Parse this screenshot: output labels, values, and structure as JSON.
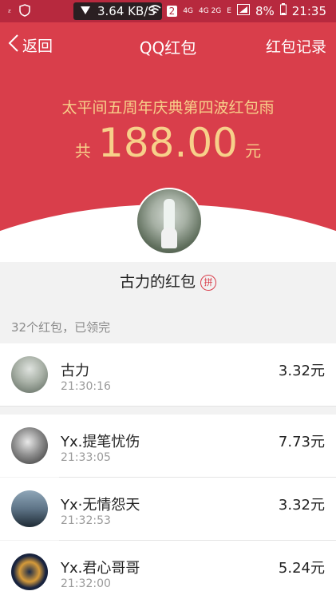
{
  "status_bar": {
    "net_speed": "3.64 KB/S",
    "sim_badge": "2",
    "battery": "8%",
    "clock": "21:35",
    "net_type_1": "4G",
    "net_type_2": "4G 2G",
    "net_type_3": "E"
  },
  "nav": {
    "back_label": "返回",
    "title": "QQ红包",
    "record_label": "红包记录"
  },
  "envelope": {
    "subtitle": "太平间五周年庆典第四波红包雨",
    "total_prefix": "共",
    "total_amount": "188.00",
    "total_suffix": "元",
    "sender_label": "古力的红包",
    "badge": "拼"
  },
  "summary": "32个红包，已领完",
  "records": [
    {
      "name": "古力",
      "time": "21:30:16",
      "amount": "3.32元"
    },
    {
      "name": "Yx.提笔忧伤",
      "time": "21:33:05",
      "amount": "7.73元"
    },
    {
      "name": "Yx·无情怨天",
      "time": "21:32:53",
      "amount": "3.32元"
    },
    {
      "name": "Yx.君心哥哥",
      "time": "21:32:00",
      "amount": "5.24元"
    }
  ],
  "colors": {
    "header_red": "#d93e4b",
    "amount_gold": "#f7d08a"
  }
}
